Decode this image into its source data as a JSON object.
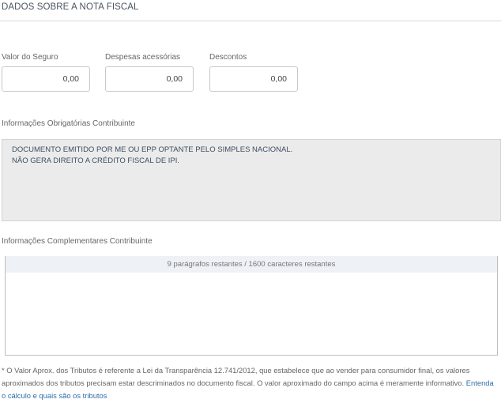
{
  "section": {
    "title": "DADOS SOBRE A NOTA FISCAL"
  },
  "fields": {
    "seguro": {
      "label": "Valor do Seguro",
      "value": "0,00"
    },
    "despesas": {
      "label": "Despesas acessórias",
      "value": "0,00"
    },
    "descontos": {
      "label": "Descontos",
      "value": "0,00"
    }
  },
  "obrigatorias": {
    "label": "Informações Obrigatórias Contribuinte",
    "lines": [
      "DOCUMENTO EMITIDO POR ME OU EPP OPTANTE PELO SIMPLES NACIONAL.",
      "NÃO GERA DIREITO A CRÉDITO FISCAL DE IPI."
    ]
  },
  "complementares": {
    "label": "Informações Complementares Contribuinte",
    "counter": "9 parágrafos restantes / 1600 caracteres restantes",
    "value": ""
  },
  "footnote": {
    "text": "* O Valor Aprox. dos Tributos é referente a Lei da Transparência 12.741/2012, que estabelece que ao vender para consumidor final, os valores aproximados dos tributos precisam estar descriminados no documento fiscal. O valor aproximado do campo acima é meramente informativo.",
    "link": "Entenda o cálculo e quais são os tributos"
  }
}
